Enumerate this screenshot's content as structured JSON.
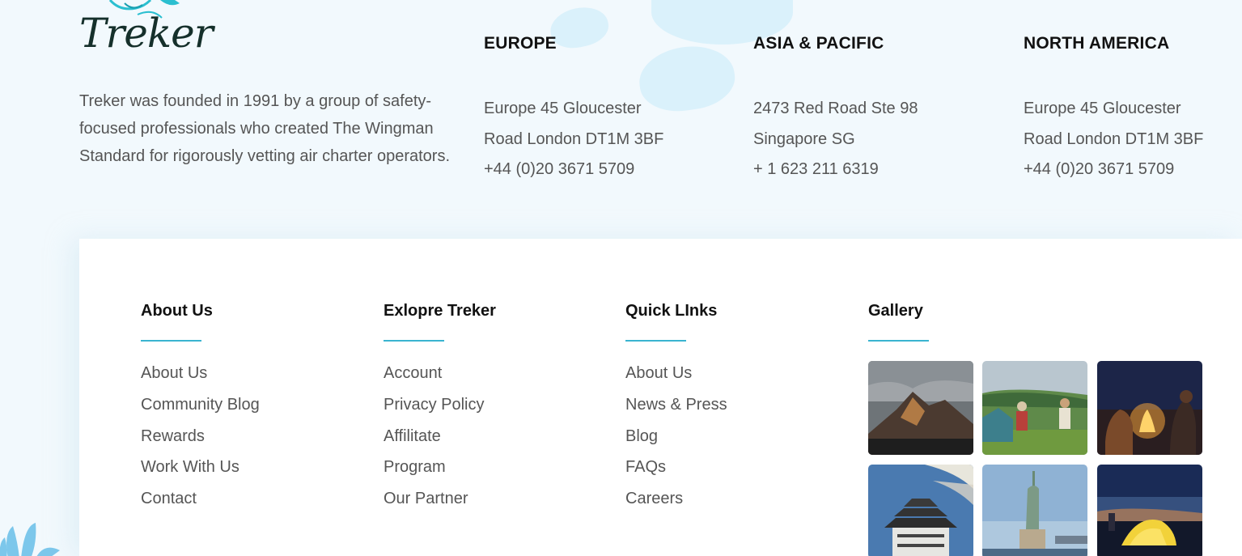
{
  "brand": {
    "name": "Treker"
  },
  "about_text": "Treker was founded in 1991 by a group of safety-focused professionals who created The Wingman Standard for rigorously vetting air charter operators.",
  "offices": [
    {
      "title": "EUROPE",
      "lines": [
        "Europe 45 Gloucester",
        "Road London DT1M 3BF",
        "+44 (0)20 3671 5709"
      ]
    },
    {
      "title": "ASIA & PACIFIC",
      "lines": [
        "2473 Red Road Ste 98",
        "Singapore SG",
        "+ 1 623 211 6319"
      ]
    },
    {
      "title": "NORTH AMERICA",
      "lines": [
        "Europe 45 Gloucester",
        "Road London DT1M 3BF",
        "+44 (0)20 3671 5709"
      ]
    }
  ],
  "columns": [
    {
      "title": "About Us",
      "links": [
        "About Us",
        "Community Blog",
        "Rewards",
        "Work With Us",
        "Contact"
      ]
    },
    {
      "title": "Exlopre Treker",
      "links": [
        "Account",
        "Privacy Policy",
        "Affilitate",
        "Program",
        "Our Partner"
      ]
    },
    {
      "title": "Quick LInks",
      "links": [
        "About Us",
        "News & Press",
        "Blog",
        "FAQs",
        "Careers"
      ]
    }
  ],
  "gallery": {
    "title": "Gallery",
    "images": [
      "mountain-peak-photo",
      "camping-picnic-photo",
      "campfire-night-photo",
      "japanese-castle-photo",
      "statue-of-liberty-photo",
      "tent-at-dusk-photo"
    ]
  },
  "colors": {
    "accent": "#3ab4d0",
    "background": "#f2f9fd",
    "heading": "#111111",
    "text": "#555555"
  }
}
